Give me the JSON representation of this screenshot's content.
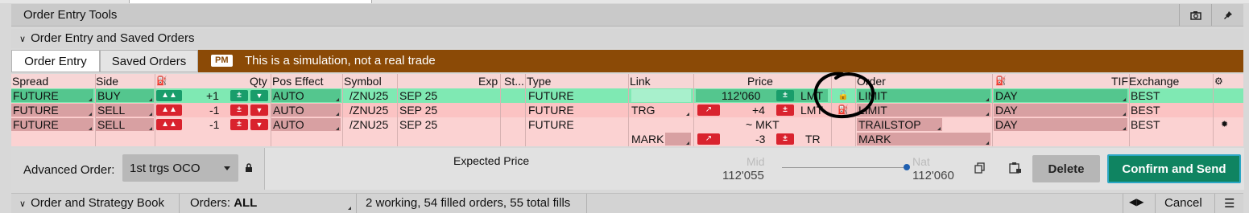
{
  "panel": {
    "title": "Order Entry Tools",
    "section_title": "Order Entry and Saved Orders",
    "tabs": [
      {
        "label": "Order Entry",
        "active": true
      },
      {
        "label": "Saved Orders",
        "active": false
      }
    ],
    "sim_badge": "PM",
    "sim_message": "This is a simulation, not a real trade"
  },
  "grid": {
    "headers": {
      "spread": "Spread",
      "side": "Side",
      "qty": "Qty",
      "pos_effect": "Pos Effect",
      "symbol": "Symbol",
      "exp": "Exp",
      "strike": "St...",
      "type": "Type",
      "link": "Link",
      "price": "Price",
      "order": "Order",
      "tif": "TIF",
      "exchange": "Exchange"
    },
    "rows": [
      {
        "spread": "FUTURE",
        "side": "BUY",
        "qty": "+1",
        "pos_effect": "AUTO",
        "symbol": "/ZNU25",
        "exp": "SEP 25",
        "type": "FUTURE",
        "link": "",
        "price": "112'060",
        "price_type": "LMT",
        "order": "LIMIT",
        "tif": "DAY",
        "exchange": "BEST",
        "color": "#7fe9b3"
      },
      {
        "spread": "FUTURE",
        "side": "SELL",
        "qty": "-1",
        "pos_effect": "AUTO",
        "symbol": "/ZNU25",
        "exp": "SEP 25",
        "type": "FUTURE",
        "link": "TRG",
        "price": "+4",
        "price_type": "LMT",
        "order": "LIMIT",
        "tif": "DAY",
        "exchange": "BEST",
        "color": "#fbc3c3"
      },
      {
        "spread": "FUTURE",
        "side": "SELL",
        "qty": "-1",
        "pos_effect": "AUTO",
        "symbol": "/ZNU25",
        "exp": "SEP 25",
        "type": "FUTURE",
        "link": "",
        "price": "~ MKT",
        "price_type": "",
        "order": "TRAILSTOP",
        "tif": "DAY",
        "exchange": "BEST",
        "color": "#fbd2d2"
      },
      {
        "link": "MARK",
        "price": "-3",
        "price_type": "TR",
        "order": "MARK"
      }
    ]
  },
  "advanced": {
    "label": "Advanced Order:",
    "value": "1st trgs OCO"
  },
  "preview": {
    "expected_price_label": "Expected  Price",
    "mid_label": "Mid",
    "mid_value": "112'055",
    "nat_label": "Nat",
    "nat_value": "112'060",
    "slider_position": 1.0
  },
  "buttons": {
    "delete": "Delete",
    "confirm": "Confirm and Send"
  },
  "book": {
    "title": "Order and Strategy Book",
    "orders_label": "Orders:",
    "orders_value": "ALL",
    "summary": "2 working, 54 filled orders, 55 total fills",
    "cancel": "Cancel"
  },
  "colors": {
    "buy_row": "#7fe9b3",
    "sell_row": "#fbc3c3",
    "sim_bar": "#8b4a06",
    "confirm_button": "#0f8461",
    "stepper_green": "#199d6b",
    "stepper_red": "#d9232e"
  }
}
